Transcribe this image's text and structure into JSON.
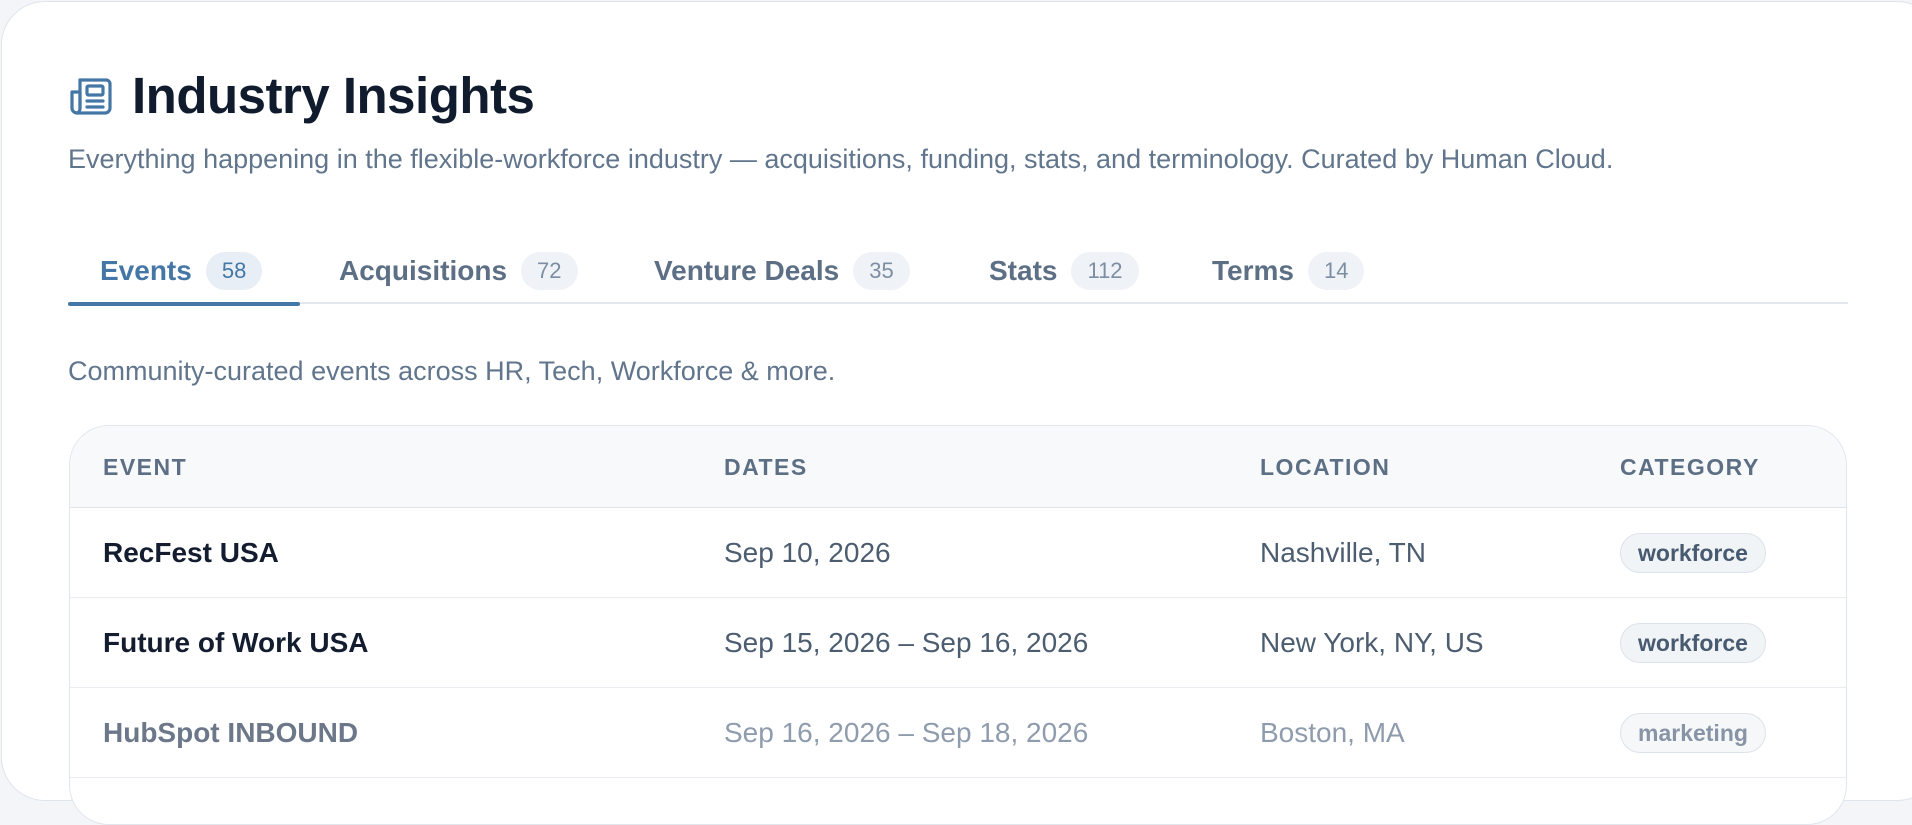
{
  "header": {
    "icon": "newspaper-icon",
    "title": "Industry Insights",
    "subtitle": "Everything happening in the flexible-workforce industry — acquisitions, funding, stats, and terminology. Curated by Human Cloud."
  },
  "tabs": [
    {
      "label": "Events",
      "count": "58",
      "active": true
    },
    {
      "label": "Acquisitions",
      "count": "72",
      "active": false
    },
    {
      "label": "Venture Deals",
      "count": "35",
      "active": false
    },
    {
      "label": "Stats",
      "count": "112",
      "active": false
    },
    {
      "label": "Terms",
      "count": "14",
      "active": false
    }
  ],
  "events_section": {
    "description": "Community-curated events across HR, Tech, Workforce & more.",
    "columns": [
      "EVENT",
      "DATES",
      "LOCATION",
      "CATEGORY"
    ],
    "rows": [
      {
        "event": "RecFest USA",
        "dates": "Sep 10, 2026",
        "location": "Nashville, TN",
        "category": "workforce"
      },
      {
        "event": "Future of Work USA",
        "dates": "Sep 15, 2026 – Sep 16, 2026",
        "location": "New York, NY, US",
        "category": "workforce"
      },
      {
        "event": "HubSpot INBOUND",
        "dates": "Sep 16, 2026 – Sep 18, 2026",
        "location": "Boston, MA",
        "category": "marketing"
      }
    ]
  },
  "colors": {
    "accent": "#4577a6",
    "title": "#111b2e",
    "muted_text": "#61758c"
  }
}
